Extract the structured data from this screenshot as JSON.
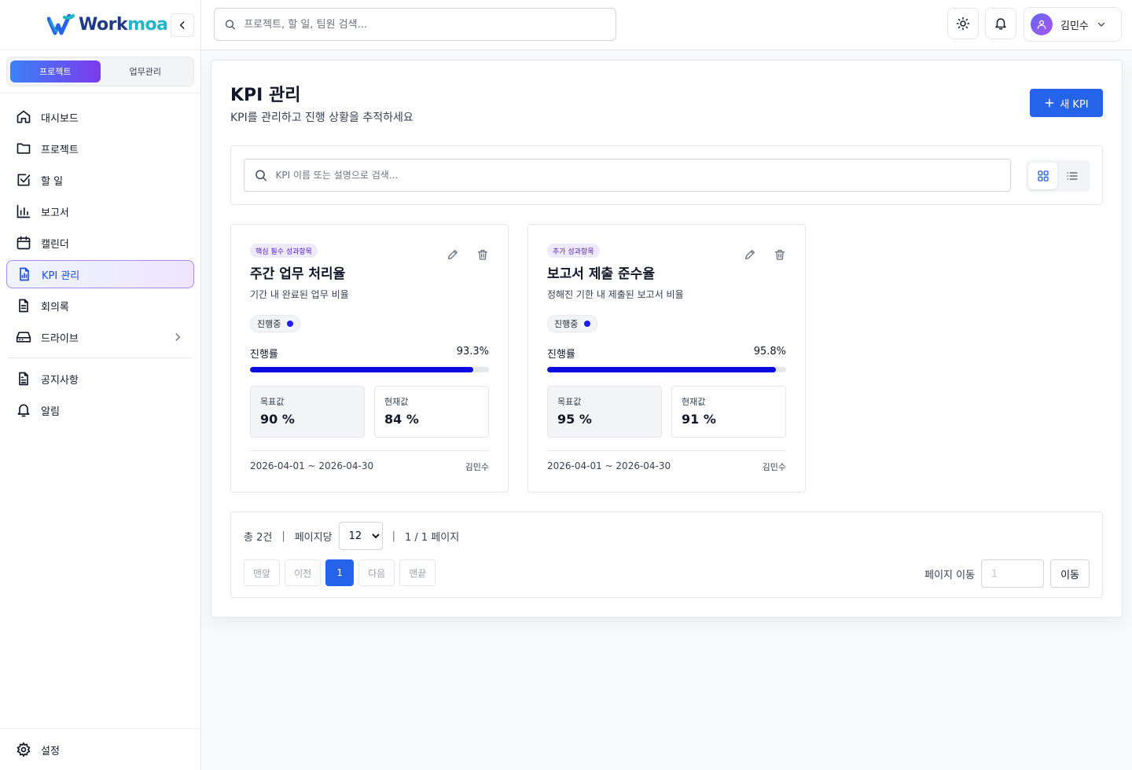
{
  "brand": {
    "name_a": "Work",
    "name_b": "moa"
  },
  "sidebar": {
    "segments": [
      {
        "label": "프로젝트",
        "active": true
      },
      {
        "label": "업무관리",
        "active": false
      }
    ],
    "items": [
      {
        "label": "대시보드",
        "icon": "home-icon"
      },
      {
        "label": "프로젝트",
        "icon": "folder-icon"
      },
      {
        "label": "할 일",
        "icon": "checkbox-icon"
      },
      {
        "label": "보고서",
        "icon": "bar-chart-icon"
      },
      {
        "label": "캘린더",
        "icon": "calendar-icon"
      },
      {
        "label": "KPI 관리",
        "icon": "kpi-doc-icon",
        "active": true
      },
      {
        "label": "회의록",
        "icon": "document-icon"
      },
      {
        "label": "드라이브",
        "icon": "drive-icon"
      }
    ],
    "extra_items": [
      {
        "label": "공지사항",
        "icon": "notice-icon"
      },
      {
        "label": "알림",
        "icon": "bell-icon"
      }
    ],
    "settings_label": "설정"
  },
  "topbar": {
    "search_placeholder": "프로젝트, 할 일, 팀원 검색...",
    "user_name": "김민수"
  },
  "page": {
    "title": "KPI 관리",
    "subtitle": "KPI를 관리하고 진행 상황을 추적하세요",
    "new_button": "새 KPI",
    "search_placeholder": "KPI 이름 또는 설명으로 검색..."
  },
  "cards": [
    {
      "badge": "핵심 필수 성과항목",
      "title": "주간 업무 처리율",
      "desc": "기간 내 완료된 업무 비율",
      "status": "진행중",
      "progress_label": "진행률",
      "progress_text": "93.3%",
      "progress": 0.933,
      "target_label": "목표값",
      "target_value": "90 %",
      "current_label": "현재값",
      "current_value": "84 %",
      "date_range": "2026-04-01 ~ 2026-04-30",
      "owner": "김민수"
    },
    {
      "badge": "추가 성과항목",
      "title": "보고서 제출 준수율",
      "desc": "정해진 기한 내 제출된 보고서 비율",
      "status": "진행중",
      "progress_label": "진행률",
      "progress_text": "95.8%",
      "progress": 0.958,
      "target_label": "목표값",
      "target_value": "95 %",
      "current_label": "현재값",
      "current_value": "91 %",
      "date_range": "2026-04-01 ~ 2026-04-30",
      "owner": "김민수"
    }
  ],
  "pager": {
    "total": "총 2건",
    "sep": "|",
    "per_page_label": "페이지당",
    "per_page_value": "12",
    "page_info": "1 / 1 페이지",
    "first": "맨앞",
    "prev": "이전",
    "current": "1",
    "next": "다음",
    "last": "맨끝",
    "goto_label": "페이지 이동",
    "goto_placeholder": "1",
    "goto_button": "이동"
  },
  "colors": {
    "accent": "#2563eb",
    "progress": "#0b0bdf",
    "badge_bg": "#ede9fe"
  }
}
